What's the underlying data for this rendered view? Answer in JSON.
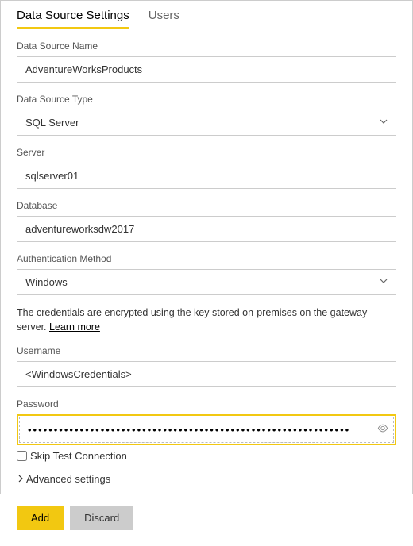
{
  "tabs": {
    "settings": "Data Source Settings",
    "users": "Users"
  },
  "fields": {
    "dsname": {
      "label": "Data Source Name",
      "value": "AdventureWorksProducts"
    },
    "dstype": {
      "label": "Data Source Type",
      "value": "SQL Server"
    },
    "server": {
      "label": "Server",
      "value": "sqlserver01"
    },
    "database": {
      "label": "Database",
      "value": "adventureworksdw2017"
    },
    "auth": {
      "label": "Authentication Method",
      "value": "Windows"
    },
    "username": {
      "label": "Username",
      "value": "<WindowsCredentials>"
    },
    "password": {
      "label": "Password",
      "value": "••••••••••••••••••••••••••••••••••••••••••••••••••••••••••••••"
    }
  },
  "info": {
    "text": "The credentials are encrypted using the key stored on-premises on the gateway server. ",
    "link": "Learn more"
  },
  "skip_test": {
    "label": "Skip Test Connection"
  },
  "advanced": {
    "label": "Advanced settings"
  },
  "buttons": {
    "add": "Add",
    "discard": "Discard"
  }
}
